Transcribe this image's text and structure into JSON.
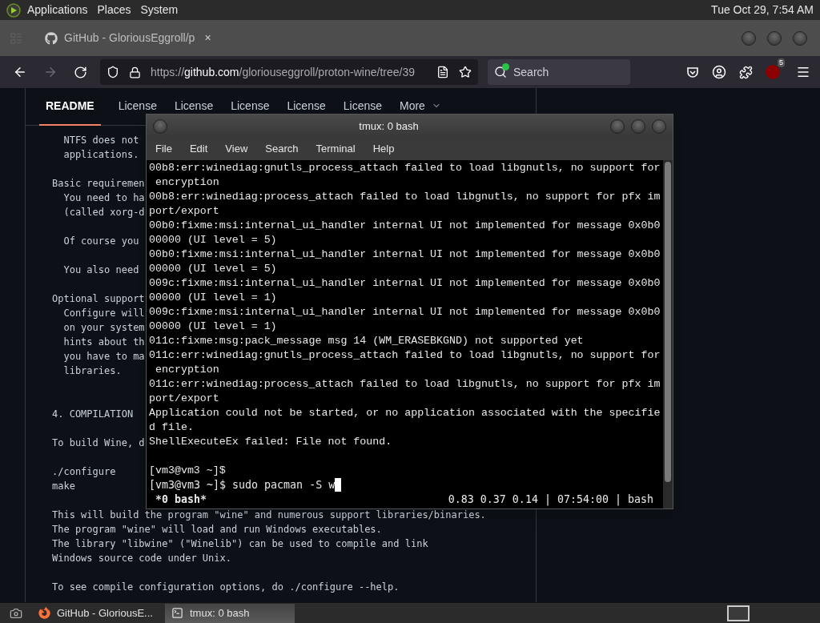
{
  "top_panel": {
    "menus": [
      "Applications",
      "Places",
      "System"
    ],
    "clock": "Tue Oct 29, 7:54 AM"
  },
  "browser": {
    "tab": {
      "title": "GitHub - GloriousEggroll/p",
      "close": "×"
    },
    "url": {
      "scheme": "https://",
      "domain": "github.com",
      "path": "/gloriouseggroll/proton-wine/tree/39"
    },
    "search": {
      "placeholder": "Search"
    },
    "extension_badge": "5",
    "readme_tabs": [
      {
        "label": "README",
        "selected": true
      },
      {
        "label": "License",
        "selected": false
      },
      {
        "label": "License",
        "selected": false
      },
      {
        "label": "License",
        "selected": false
      },
      {
        "label": "License",
        "selected": false
      },
      {
        "label": "License",
        "selected": false
      },
      {
        "label": "More",
        "selected": false
      }
    ],
    "readme_blocks": [
      "  NTFS does not\n  applications.\n\nBasic requiremen\n  You need to ha\n  (called xorg-d\n\n  Of course you\n\n  You also need\n\nOptional support\n  Configure will\n  on your system\n  hints about th\n  you have to ma\n  libraries.\n\n\n4. COMPILATION\n\nTo build Wine, d\n\n./configure\nmake",
      "This will build the program \"wine\" and numerous support libraries/binaries.\nThe program \"wine\" will load and run Windows executables.\nThe library \"libwine\" (\"Winelib\") can be used to compile and link\nWindows source code under Unix.\n\nTo see compile configuration options, do ./configure --help."
    ]
  },
  "terminal": {
    "title": "tmux: 0 bash",
    "menu": [
      "File",
      "Edit",
      "View",
      "Search",
      "Terminal",
      "Help"
    ],
    "output": "00b8:err:winediag:gnutls_process_attach failed to load libgnutls, no support for\n encryption\n00b8:err:winediag:process_attach failed to load libgnutls, no support for pfx im\nport/export\n00b0:fixme:msi:internal_ui_handler internal UI not implemented for message 0x0b0\n00000 (UI level = 5)\n00b0:fixme:msi:internal_ui_handler internal UI not implemented for message 0x0b0\n00000 (UI level = 5)\n009c:fixme:msi:internal_ui_handler internal UI not implemented for message 0x0b0\n00000 (UI level = 1)\n009c:fixme:msi:internal_ui_handler internal UI not implemented for message 0x0b0\n00000 (UI level = 1)\n011c:fixme:msg:pack_message msg 14 (WM_ERASEBKGND) not supported yet\n011c:err:winediag:gnutls_process_attach failed to load libgnutls, no support for\n encryption\n011c:err:winediag:process_attach failed to load libgnutls, no support for pfx im\nport/export\nApplication could not be started, or no application associated with the specifie\nd file.\nShellExecuteEx failed: File not found.\n\n[vm3@vm3 ~]$",
    "prompt_line": "[vm3@vm3 ~]$ sudo pacman -S w",
    "status_left": "*0 bash*",
    "status_right": "0.83 0.37 0.14 | 07:54:00 | bash"
  },
  "taskbar": {
    "items": [
      {
        "label": "GitHub - GloriousE...",
        "kind": "browser",
        "selected": false
      },
      {
        "label": "tmux: 0 bash",
        "kind": "terminal",
        "selected": true
      }
    ]
  }
}
